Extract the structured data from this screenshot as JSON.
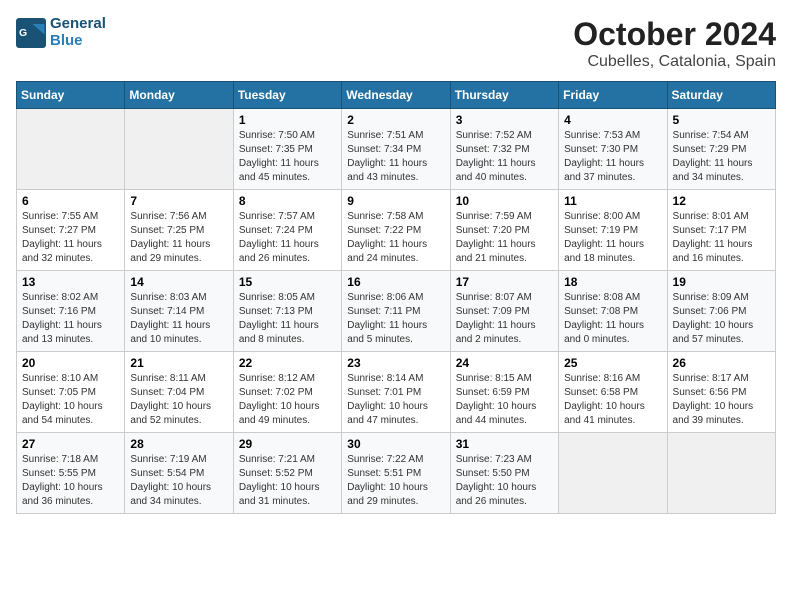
{
  "header": {
    "logo_general": "General",
    "logo_blue": "Blue",
    "title": "October 2024",
    "subtitle": "Cubelles, Catalonia, Spain"
  },
  "columns": [
    "Sunday",
    "Monday",
    "Tuesday",
    "Wednesday",
    "Thursday",
    "Friday",
    "Saturday"
  ],
  "weeks": [
    [
      {
        "day": "",
        "content": ""
      },
      {
        "day": "",
        "content": ""
      },
      {
        "day": "1",
        "content": "Sunrise: 7:50 AM\nSunset: 7:35 PM\nDaylight: 11 hours and 45 minutes."
      },
      {
        "day": "2",
        "content": "Sunrise: 7:51 AM\nSunset: 7:34 PM\nDaylight: 11 hours and 43 minutes."
      },
      {
        "day": "3",
        "content": "Sunrise: 7:52 AM\nSunset: 7:32 PM\nDaylight: 11 hours and 40 minutes."
      },
      {
        "day": "4",
        "content": "Sunrise: 7:53 AM\nSunset: 7:30 PM\nDaylight: 11 hours and 37 minutes."
      },
      {
        "day": "5",
        "content": "Sunrise: 7:54 AM\nSunset: 7:29 PM\nDaylight: 11 hours and 34 minutes."
      }
    ],
    [
      {
        "day": "6",
        "content": "Sunrise: 7:55 AM\nSunset: 7:27 PM\nDaylight: 11 hours and 32 minutes."
      },
      {
        "day": "7",
        "content": "Sunrise: 7:56 AM\nSunset: 7:25 PM\nDaylight: 11 hours and 29 minutes."
      },
      {
        "day": "8",
        "content": "Sunrise: 7:57 AM\nSunset: 7:24 PM\nDaylight: 11 hours and 26 minutes."
      },
      {
        "day": "9",
        "content": "Sunrise: 7:58 AM\nSunset: 7:22 PM\nDaylight: 11 hours and 24 minutes."
      },
      {
        "day": "10",
        "content": "Sunrise: 7:59 AM\nSunset: 7:20 PM\nDaylight: 11 hours and 21 minutes."
      },
      {
        "day": "11",
        "content": "Sunrise: 8:00 AM\nSunset: 7:19 PM\nDaylight: 11 hours and 18 minutes."
      },
      {
        "day": "12",
        "content": "Sunrise: 8:01 AM\nSunset: 7:17 PM\nDaylight: 11 hours and 16 minutes."
      }
    ],
    [
      {
        "day": "13",
        "content": "Sunrise: 8:02 AM\nSunset: 7:16 PM\nDaylight: 11 hours and 13 minutes."
      },
      {
        "day": "14",
        "content": "Sunrise: 8:03 AM\nSunset: 7:14 PM\nDaylight: 11 hours and 10 minutes."
      },
      {
        "day": "15",
        "content": "Sunrise: 8:05 AM\nSunset: 7:13 PM\nDaylight: 11 hours and 8 minutes."
      },
      {
        "day": "16",
        "content": "Sunrise: 8:06 AM\nSunset: 7:11 PM\nDaylight: 11 hours and 5 minutes."
      },
      {
        "day": "17",
        "content": "Sunrise: 8:07 AM\nSunset: 7:09 PM\nDaylight: 11 hours and 2 minutes."
      },
      {
        "day": "18",
        "content": "Sunrise: 8:08 AM\nSunset: 7:08 PM\nDaylight: 11 hours and 0 minutes."
      },
      {
        "day": "19",
        "content": "Sunrise: 8:09 AM\nSunset: 7:06 PM\nDaylight: 10 hours and 57 minutes."
      }
    ],
    [
      {
        "day": "20",
        "content": "Sunrise: 8:10 AM\nSunset: 7:05 PM\nDaylight: 10 hours and 54 minutes."
      },
      {
        "day": "21",
        "content": "Sunrise: 8:11 AM\nSunset: 7:04 PM\nDaylight: 10 hours and 52 minutes."
      },
      {
        "day": "22",
        "content": "Sunrise: 8:12 AM\nSunset: 7:02 PM\nDaylight: 10 hours and 49 minutes."
      },
      {
        "day": "23",
        "content": "Sunrise: 8:14 AM\nSunset: 7:01 PM\nDaylight: 10 hours and 47 minutes."
      },
      {
        "day": "24",
        "content": "Sunrise: 8:15 AM\nSunset: 6:59 PM\nDaylight: 10 hours and 44 minutes."
      },
      {
        "day": "25",
        "content": "Sunrise: 8:16 AM\nSunset: 6:58 PM\nDaylight: 10 hours and 41 minutes."
      },
      {
        "day": "26",
        "content": "Sunrise: 8:17 AM\nSunset: 6:56 PM\nDaylight: 10 hours and 39 minutes."
      }
    ],
    [
      {
        "day": "27",
        "content": "Sunrise: 7:18 AM\nSunset: 5:55 PM\nDaylight: 10 hours and 36 minutes."
      },
      {
        "day": "28",
        "content": "Sunrise: 7:19 AM\nSunset: 5:54 PM\nDaylight: 10 hours and 34 minutes."
      },
      {
        "day": "29",
        "content": "Sunrise: 7:21 AM\nSunset: 5:52 PM\nDaylight: 10 hours and 31 minutes."
      },
      {
        "day": "30",
        "content": "Sunrise: 7:22 AM\nSunset: 5:51 PM\nDaylight: 10 hours and 29 minutes."
      },
      {
        "day": "31",
        "content": "Sunrise: 7:23 AM\nSunset: 5:50 PM\nDaylight: 10 hours and 26 minutes."
      },
      {
        "day": "",
        "content": ""
      },
      {
        "day": "",
        "content": ""
      }
    ]
  ]
}
